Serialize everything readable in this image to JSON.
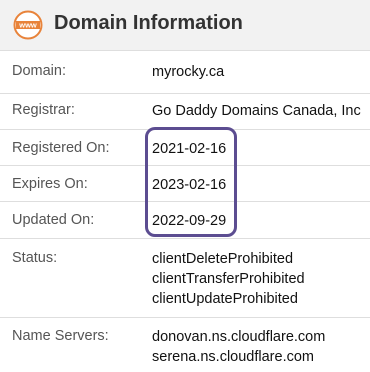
{
  "header": {
    "title": "Domain Information",
    "icon": "www-icon",
    "icon_text": "www",
    "icon_color": "#e8833a"
  },
  "rows": [
    {
      "label": "Domain:",
      "value": "myrocky.ca"
    },
    {
      "label": "Registrar:",
      "value": "Go Daddy Domains Canada, Inc"
    },
    {
      "label": "Registered On:",
      "value": "2021-02-16"
    },
    {
      "label": "Expires On:",
      "value": "2023-02-16"
    },
    {
      "label": "Updated On:",
      "value": "2022-09-29"
    },
    {
      "label": "Status:",
      "values": [
        "clientDeleteProhibited",
        "clientTransferProhibited",
        "clientUpdateProhibited"
      ]
    },
    {
      "label": "Name Servers:",
      "values": [
        "donovan.ns.cloudflare.com",
        "serena.ns.cloudflare.com"
      ]
    }
  ],
  "colors": {
    "highlight": "#5c4d91",
    "header_bg": "#f2f2f2"
  }
}
